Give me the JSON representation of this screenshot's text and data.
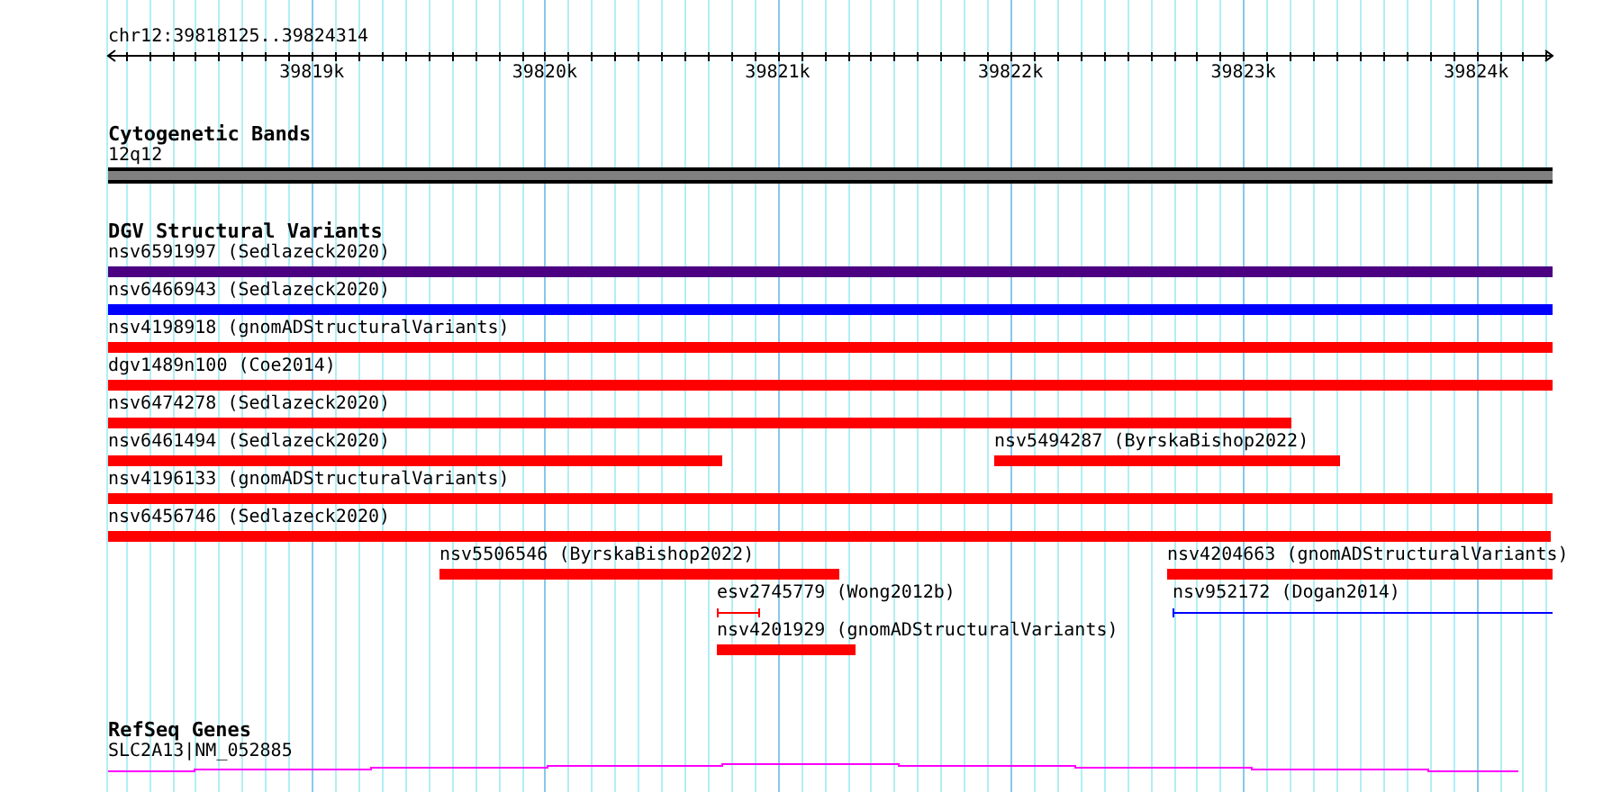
{
  "ruler": {
    "location": "chr12:39818125..39824314",
    "ticks": [
      "39819k",
      "39820k",
      "39821k",
      "39822k",
      "39823k",
      "39824k"
    ]
  },
  "cytogenetic_bands": {
    "title": "Cytogenetic Bands",
    "band": {
      "label": "12q12",
      "color": "#808080"
    }
  },
  "dgv_structural_variants": {
    "title": "DGV Structural Variants",
    "rows": [
      [
        {
          "kind": "bar",
          "label": "nsv6591997 (Sedlazeck2020)",
          "color": "#4b0082"
        }
      ],
      [
        {
          "kind": "bar",
          "label": "nsv6466943 (Sedlazeck2020)",
          "color": "#0000ff"
        }
      ],
      [
        {
          "kind": "bar",
          "label": "nsv4198918 (gnomADStructuralVariants)",
          "color": "#ff0000"
        }
      ],
      [
        {
          "kind": "bar",
          "label": "dgv1489n100 (Coe2014)",
          "color": "#ff0000"
        }
      ],
      [
        {
          "kind": "bar",
          "label": "nsv6474278 (Sedlazeck2020)",
          "color": "#ff0000"
        }
      ],
      [
        {
          "kind": "bar",
          "label": "nsv6461494 (Sedlazeck2020)",
          "color": "#ff0000"
        },
        {
          "kind": "bar",
          "label": "nsv5494287 (ByrskaBishop2022)",
          "color": "#ff0000"
        }
      ],
      [
        {
          "kind": "bar",
          "label": "nsv4196133 (gnomADStructuralVariants)",
          "color": "#ff0000"
        }
      ],
      [
        {
          "kind": "bar",
          "label": "nsv6456746 (Sedlazeck2020)",
          "color": "#ff0000"
        }
      ],
      [
        {
          "kind": "bar",
          "label": "nsv5506546 (ByrskaBishop2022)",
          "color": "#ff0000"
        },
        {
          "kind": "bar",
          "label": "nsv4204663 (gnomADStructuralVariants)",
          "color": "#ff0000"
        }
      ],
      [
        {
          "kind": "line",
          "label": "esv2745779 (Wong2012b)",
          "color": "#ff0000"
        },
        {
          "kind": "line",
          "label": "nsv952172 (Dogan2014)",
          "color": "#0000ff"
        }
      ],
      [
        {
          "kind": "bar",
          "label": "nsv4201929 (gnomADStructuralVariants)",
          "color": "#ff0000"
        }
      ]
    ]
  },
  "refseq_genes": {
    "title": "RefSeq Genes",
    "gene": {
      "label": "SLC2A13|NM_052885",
      "color": "#ff00ff"
    }
  }
}
